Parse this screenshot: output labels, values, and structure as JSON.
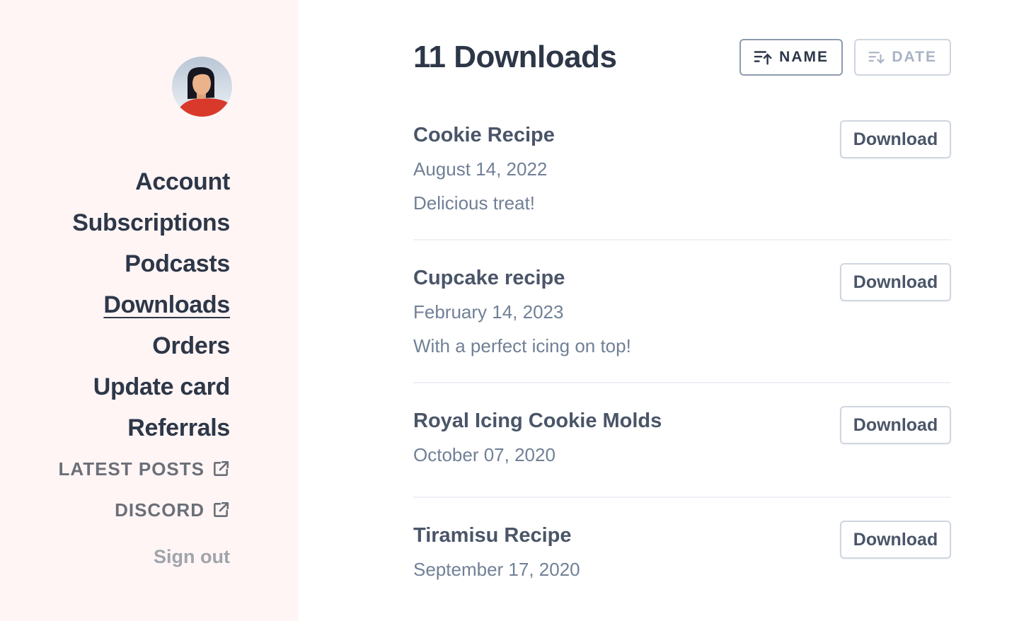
{
  "sidebar": {
    "avatar_alt": "user avatar",
    "nav": [
      {
        "label": "Account",
        "active": false
      },
      {
        "label": "Subscriptions",
        "active": false
      },
      {
        "label": "Podcasts",
        "active": false
      },
      {
        "label": "Downloads",
        "active": true
      },
      {
        "label": "Orders",
        "active": false
      },
      {
        "label": "Update card",
        "active": false
      },
      {
        "label": "Referrals",
        "active": false
      }
    ],
    "external_links": [
      {
        "label": "LATEST POSTS",
        "icon": "external-link-icon"
      },
      {
        "label": "DISCORD",
        "icon": "external-link-icon"
      }
    ],
    "sign_out": "Sign out"
  },
  "main": {
    "title": "11 Downloads",
    "sort": {
      "name_label": "NAME",
      "name_icon": "sort-ascending-icon",
      "date_label": "DATE",
      "date_icon": "sort-descending-icon",
      "active": "name"
    },
    "download_label": "Download",
    "items": [
      {
        "name": "Cookie Recipe",
        "date": "August 14, 2022",
        "description": "Delicious treat!"
      },
      {
        "name": "Cupcake recipe",
        "date": "February 14, 2023",
        "description": "With a perfect icing on top!"
      },
      {
        "name": "Royal Icing Cookie Molds",
        "date": "October 07, 2020",
        "description": ""
      },
      {
        "name": "Tiramisu Recipe",
        "date": "September 17, 2020",
        "description": ""
      }
    ]
  },
  "colors": {
    "sidebar_bg": "#fff5f5",
    "text_primary": "#2d3748",
    "text_secondary": "#718096",
    "border": "#cfd6e0"
  }
}
